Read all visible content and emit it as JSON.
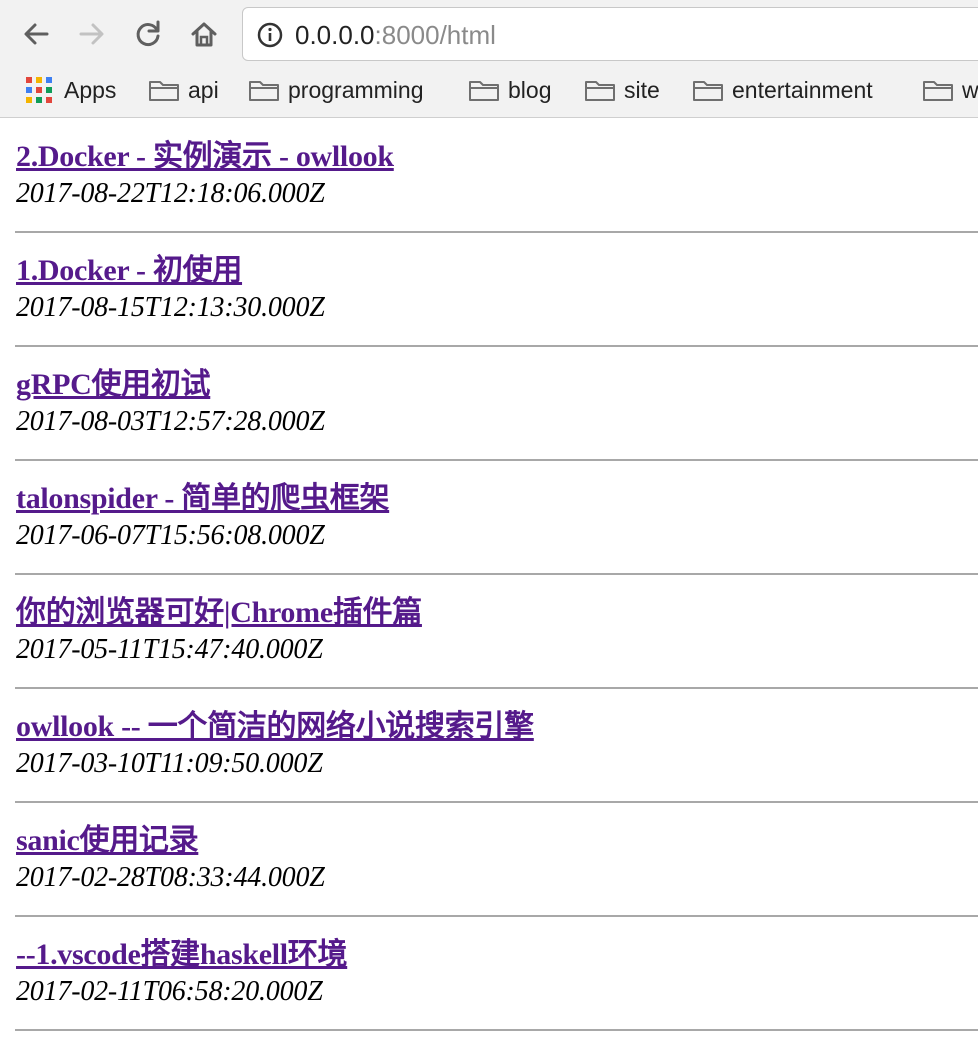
{
  "toolbar": {
    "url_host": "0.0.0.0",
    "url_path": ":8000/html"
  },
  "bookmarks": [
    {
      "label": "Apps",
      "icon": "apps-grid-icon"
    },
    {
      "label": "api",
      "icon": "folder-icon"
    },
    {
      "label": "programming",
      "icon": "folder-icon"
    },
    {
      "label": "blog",
      "icon": "folder-icon"
    },
    {
      "label": "site",
      "icon": "folder-icon"
    },
    {
      "label": "entertainment",
      "icon": "folder-icon"
    },
    {
      "label": "w",
      "icon": "folder-icon"
    }
  ],
  "posts": [
    {
      "title": "2.Docker - 实例演示 - owllook",
      "date": "2017-08-22T12:18:06.000Z"
    },
    {
      "title": "1.Docker - 初使用",
      "date": "2017-08-15T12:13:30.000Z"
    },
    {
      "title": "gRPC使用初试",
      "date": "2017-08-03T12:57:28.000Z"
    },
    {
      "title": "talonspider - 简单的爬虫框架",
      "date": "2017-06-07T15:56:08.000Z"
    },
    {
      "title": "你的浏览器可好|Chrome插件篇",
      "date": "2017-05-11T15:47:40.000Z"
    },
    {
      "title": "owllook -- 一个简洁的网络小说搜索引擎",
      "date": "2017-03-10T11:09:50.000Z"
    },
    {
      "title": "sanic使用记录",
      "date": "2017-02-28T08:33:44.000Z"
    },
    {
      "title": "--1.vscode搭建haskell环境",
      "date": "2017-02-11T06:58:20.000Z"
    }
  ],
  "colors": {
    "link_visited": "#551a8b",
    "divider": "#a8a8a8",
    "chrome_bg": "#f2f2f2"
  }
}
